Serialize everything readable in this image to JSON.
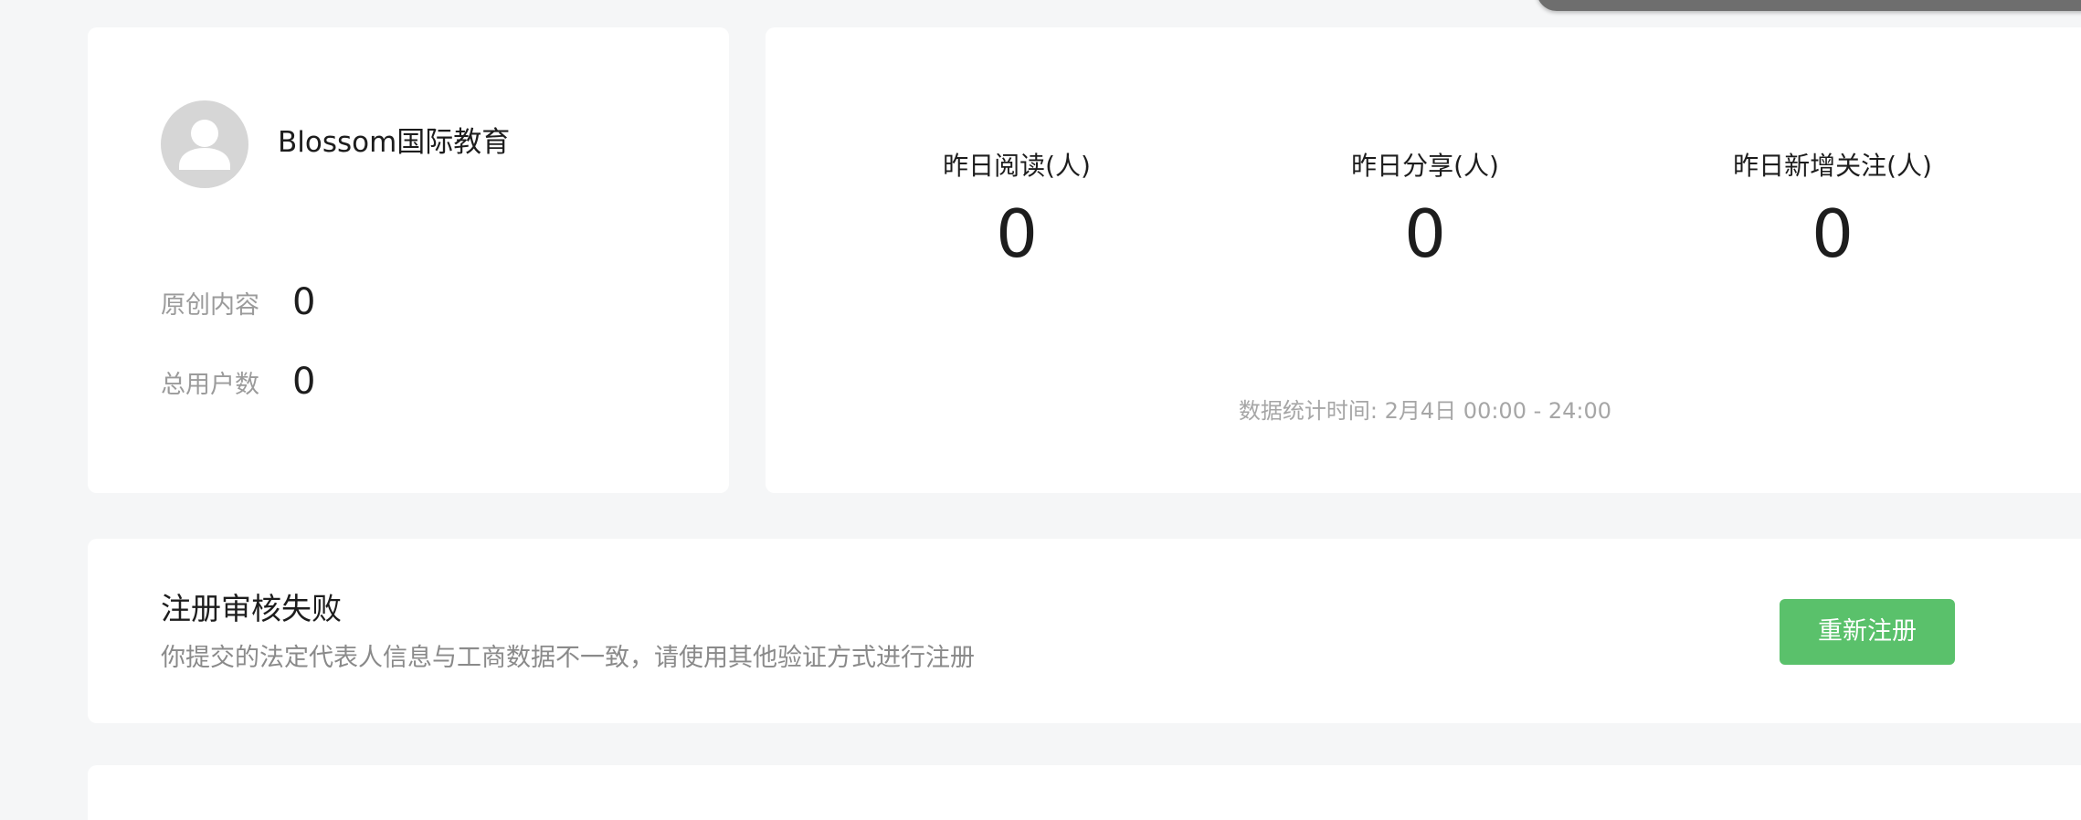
{
  "profile": {
    "org_name": "Blossom国际教育",
    "stats": [
      {
        "label": "原创内容",
        "value": "0"
      },
      {
        "label": "总用户数",
        "value": "0"
      }
    ]
  },
  "metrics": {
    "items": [
      {
        "label": "昨日阅读(人)",
        "value": "0"
      },
      {
        "label": "昨日分享(人)",
        "value": "0"
      },
      {
        "label": "昨日新增关注(人)",
        "value": "0"
      }
    ],
    "stat_time": "数据统计时间: 2月4日 00:00 - 24:00"
  },
  "notice": {
    "title": "注册审核失败",
    "description": "你提交的法定代表人信息与工商数据不一致，请使用其他验证方式进行注册",
    "button_label": "重新注册"
  },
  "colors": {
    "page_background": "#f5f6f7",
    "card_background": "#ffffff",
    "primary_button": "#5ac16b",
    "secondary_text": "#9b9b9b"
  },
  "icons": {
    "avatar": "user-avatar-placeholder-icon"
  }
}
